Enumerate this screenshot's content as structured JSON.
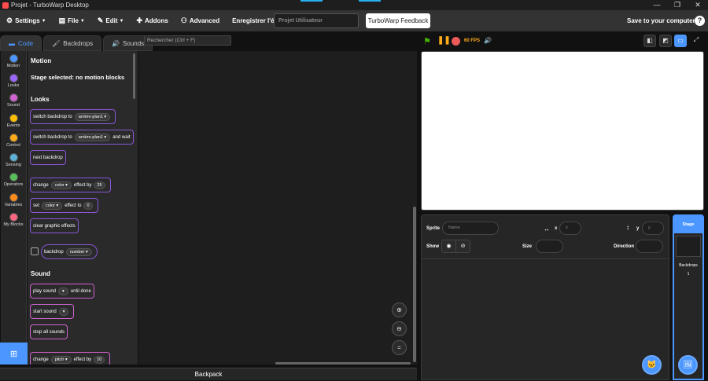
{
  "window": {
    "title": "Projet - TurboWarp Desktop",
    "minimize": "—",
    "maximize": "❐",
    "close": "✕"
  },
  "menu": {
    "settings": "Settings",
    "file": "File",
    "edit": "Edit",
    "addons": "Addons",
    "advanced": "Advanced",
    "save_screen": "Enregistrer l'écran",
    "title_placeholder": "Projet Utilisateur",
    "feedback": "TurboWarp Feedback",
    "save_computer": "Save to your computer",
    "help": "?"
  },
  "tabs": [
    {
      "label": "Code",
      "icon": "code-icon"
    },
    {
      "label": "Backdrops",
      "icon": "brush-icon"
    },
    {
      "label": "Sounds",
      "icon": "speaker-icon"
    }
  ],
  "categories": [
    {
      "label": "Motion",
      "color": "#4c97ff"
    },
    {
      "label": "Looks",
      "color": "#9966ff"
    },
    {
      "label": "Sound",
      "color": "#cf63cf"
    },
    {
      "label": "Events",
      "color": "#ffbf00"
    },
    {
      "label": "Control",
      "color": "#ffab19"
    },
    {
      "label": "Sensing",
      "color": "#5cb1d6"
    },
    {
      "label": "Operators",
      "color": "#59c059"
    },
    {
      "label": "Variables",
      "color": "#ff8c1a"
    },
    {
      "label": "My Blocks",
      "color": "#ff6680"
    }
  ],
  "palette": {
    "motion_heading": "Motion",
    "motion_note": "Stage selected: no motion blocks",
    "looks_heading": "Looks",
    "switch_backdrop": "switch backdrop to",
    "backdrop_value": "arrière-plan1",
    "and_wait": "and wait",
    "next_backdrop": "next backdrop",
    "change": "change",
    "color": "color",
    "effect_by": "effect by",
    "change_value": "25",
    "set": "set",
    "effect_to": "effect to",
    "set_value": "0",
    "clear_effects": "clear graphic effects",
    "backdrop": "backdrop",
    "number": "number",
    "sound_heading": "Sound",
    "play_sound": "play sound",
    "until_done": "until done",
    "start_sound": "start sound",
    "stop_all_sounds": "stop all sounds",
    "pitch": "pitch",
    "pitch_value": "10"
  },
  "workspace": {
    "search_placeholder": "Rechercher (Ctrl + F)",
    "backpack": "Backpack"
  },
  "stage_controls": {
    "fps": "60 FPS"
  },
  "sprite_info": {
    "sprite_label": "Sprite",
    "name_placeholder": "Name",
    "x_label": "x",
    "x_placeholder": "x",
    "y_label": "y",
    "y_placeholder": "y",
    "show_label": "Show",
    "size_label": "Size",
    "direction_label": "Direction"
  },
  "stage_pane": {
    "tab": "Stage",
    "backdrops_label": "Backdrops",
    "backdrops_count": "1"
  }
}
